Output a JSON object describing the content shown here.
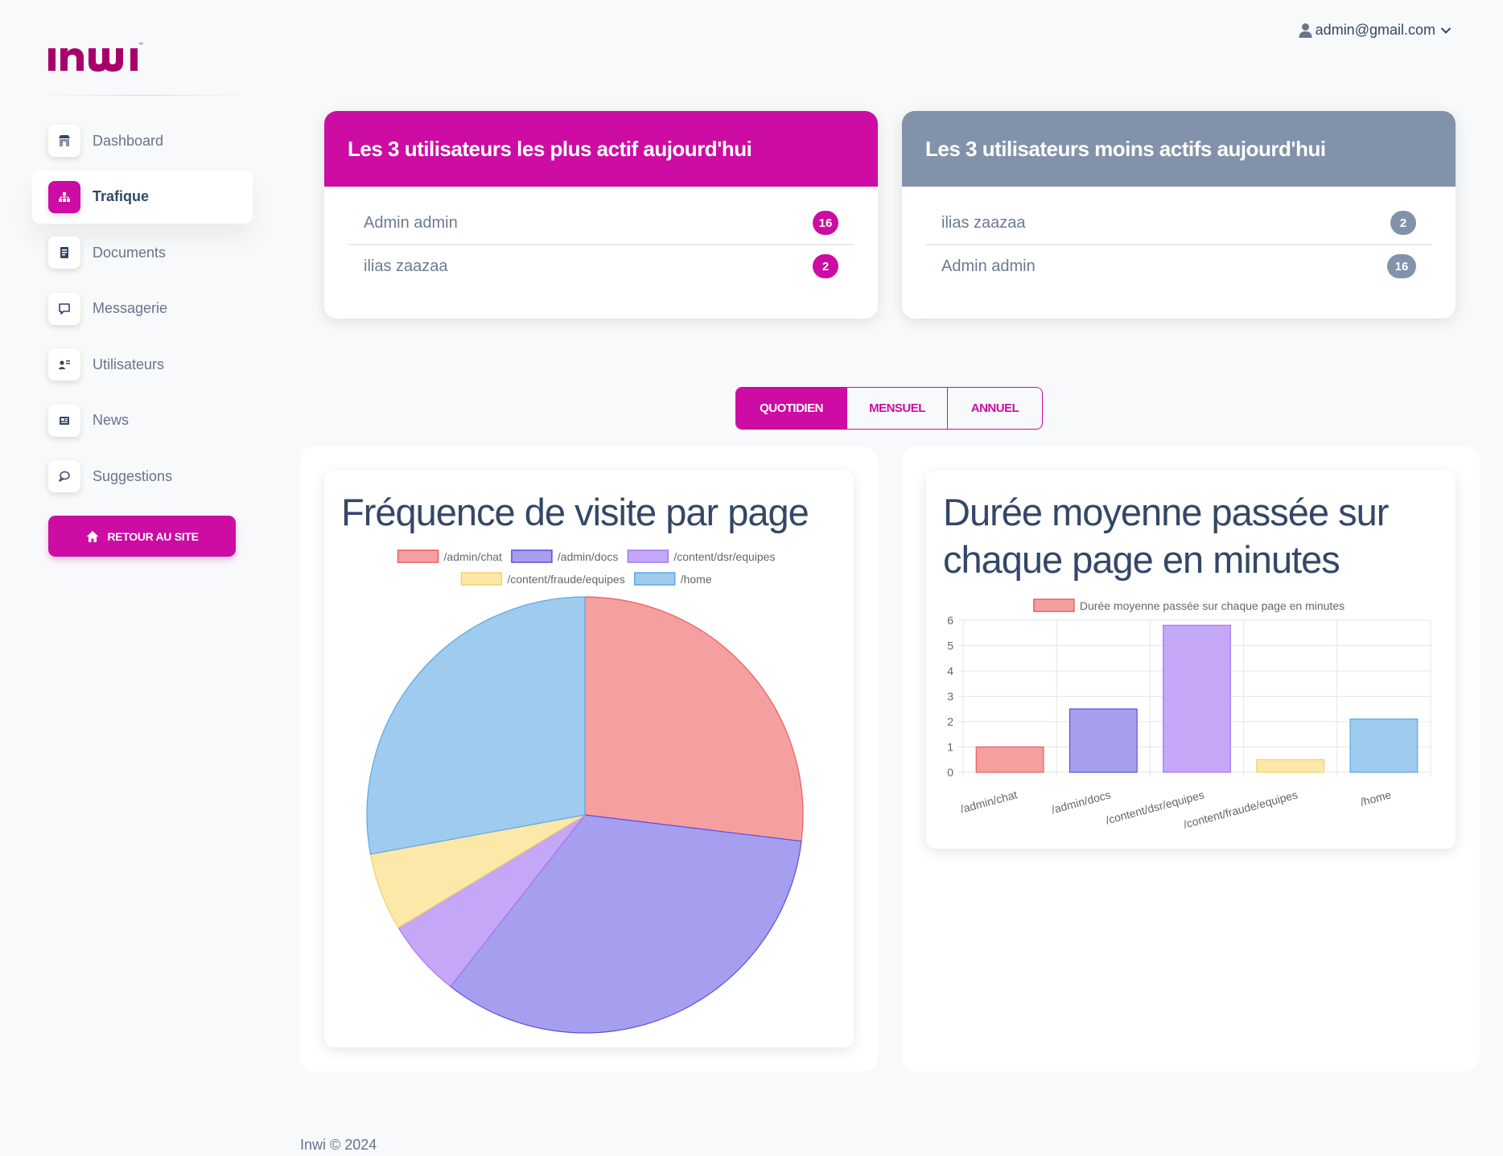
{
  "brand": {
    "logo_text": "inwi"
  },
  "sidebar": {
    "items": [
      {
        "label": "Dashboard",
        "icon": "shop-icon"
      },
      {
        "label": "Trafique",
        "icon": "sitemap-icon",
        "active": true
      },
      {
        "label": "Documents",
        "icon": "document-icon"
      },
      {
        "label": "Messagerie",
        "icon": "chat-square-icon"
      },
      {
        "label": "Utilisateurs",
        "icon": "user-card-icon"
      },
      {
        "label": "News",
        "icon": "newspaper-icon"
      },
      {
        "label": "Suggestions",
        "icon": "chat-bubble-icon"
      }
    ],
    "back_button": "RETOUR AU SITE"
  },
  "header": {
    "user_email": "admin@gmail.com"
  },
  "top_users": {
    "title": "Les 3 utilisateurs les plus actif aujourd'hui",
    "color": "#cc0ca3",
    "rows": [
      {
        "name": "Admin admin",
        "count": "16"
      },
      {
        "name": "ilias zaazaa",
        "count": "2"
      }
    ]
  },
  "least_users": {
    "title": "Les 3 utilisateurs moins actifs aujourd'hui",
    "color": "#8392ab",
    "rows": [
      {
        "name": "ilias zaazaa",
        "count": "2"
      },
      {
        "name": "Admin admin",
        "count": "16"
      }
    ]
  },
  "period_tabs": [
    {
      "label": "QUOTIDIEN",
      "active": true
    },
    {
      "label": "MENSUEL"
    },
    {
      "label": "ANNUEL"
    }
  ],
  "chart_data": [
    {
      "type": "pie",
      "title": "Fréquence de visite par page",
      "categories": [
        "/admin/chat",
        "/admin/docs",
        "/content/dsr/equipes",
        "/content/fraude/equipes",
        "/home"
      ],
      "values": [
        28,
        35,
        6,
        6,
        29
      ],
      "colors": [
        "#f5a0a0",
        "#a69ff0",
        "#c5a7f7",
        "#fce8a8",
        "#9fcbee"
      ],
      "borders": [
        "#f05b5b",
        "#5a4fe0",
        "#a479f2",
        "#f4d068",
        "#5ba8e3"
      ],
      "legend": "top"
    },
    {
      "type": "bar",
      "title": "Durée moyenne passée sur chaque page en minutes",
      "categories": [
        "/admin/chat",
        "/admin/docs",
        "/content/dsr/equipes",
        "/content/fraude/equipes",
        "/home"
      ],
      "series": [
        {
          "name": "Durée moyenne passée sur chaque page en minutes",
          "values": [
            1,
            2.5,
            5.8,
            0.5,
            2.1
          ]
        }
      ],
      "colors": [
        "#f5a0a0",
        "#a69ff0",
        "#c5a7f7",
        "#fce8a8",
        "#9fcbee"
      ],
      "borders": [
        "#f05b5b",
        "#5a4fe0",
        "#a479f2",
        "#f4d068",
        "#5ba8e3"
      ],
      "ylim": [
        0,
        6
      ],
      "yticks": [
        0,
        1,
        2,
        3,
        4,
        5,
        6
      ],
      "grid": true,
      "legend": "top"
    }
  ],
  "footer": {
    "text": "Inwi © 2024"
  }
}
